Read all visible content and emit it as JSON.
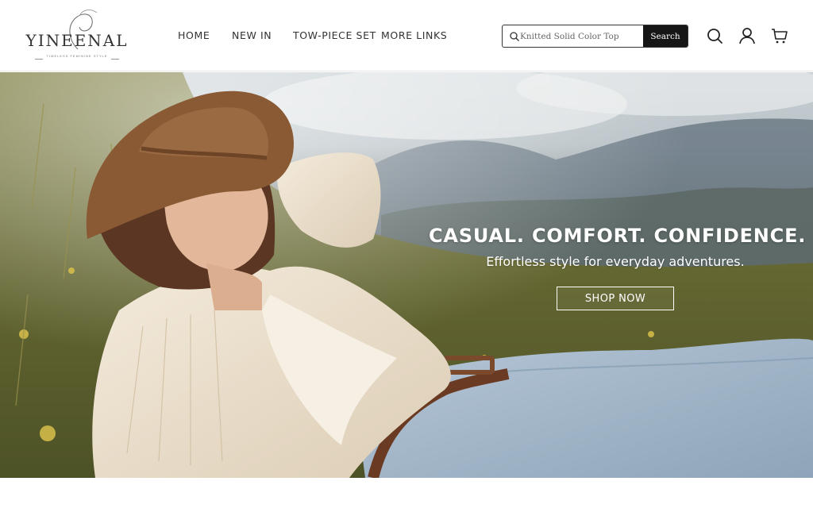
{
  "brand": {
    "name": "YINEENAL",
    "tagline": "TIMELESS FEMININE STYLE"
  },
  "nav": {
    "items": [
      {
        "label": "HOME"
      },
      {
        "label": "NEW IN"
      },
      {
        "label": "TOW-PIECE SET"
      },
      {
        "label": "MORE LINKS"
      }
    ]
  },
  "search": {
    "placeholder": "Knitted Solid Color Top",
    "button_label": "Search"
  },
  "header_icons": [
    "search-icon",
    "account-icon",
    "cart-icon"
  ],
  "hero": {
    "title": "CASUAL. COMFORT. CONFIDENCE.",
    "subtitle": "Effortless style for everyday adventures.",
    "cta_label": "SHOP NOW"
  },
  "colors": {
    "button_dark": "#161616",
    "hat_brown": "#8a5a35",
    "denim": "#9fb5c9",
    "shirt_cream": "#efe4d2"
  }
}
